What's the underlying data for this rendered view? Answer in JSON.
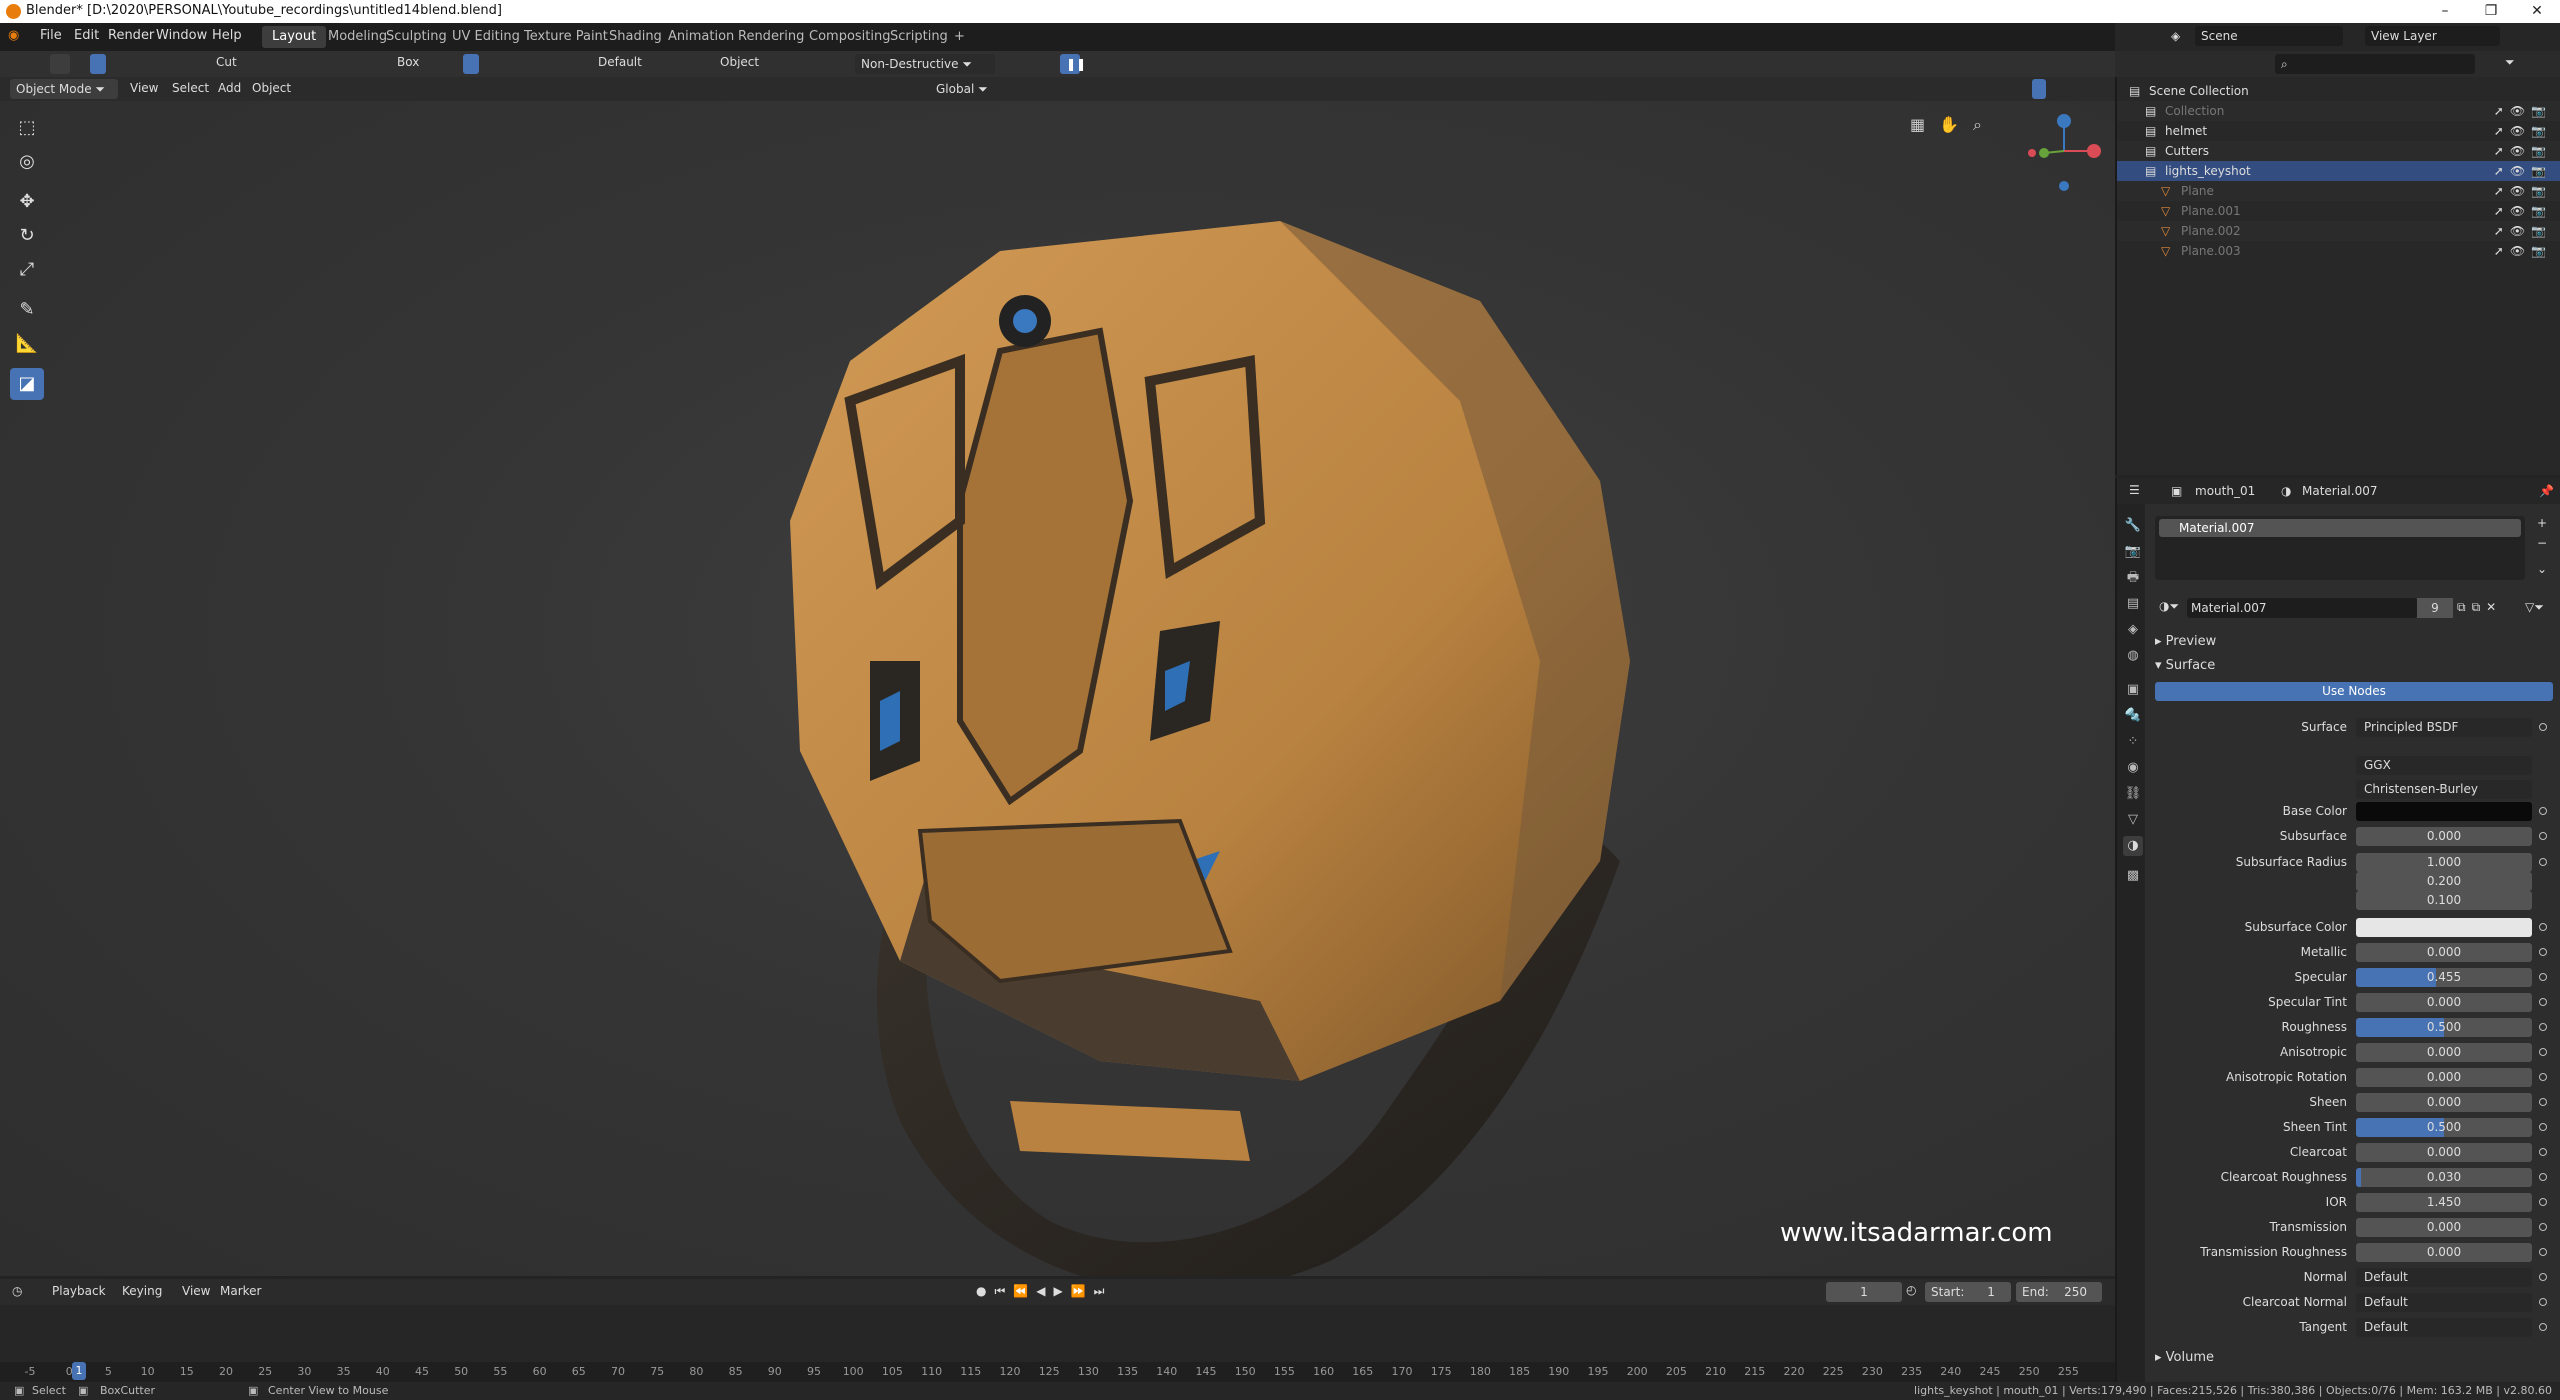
{
  "window": {
    "title": "Blender* [D:\\2020\\PERSONAL\\Youtube_recordings\\untitled14blend.blend]",
    "min": "–",
    "max": "❐",
    "close": "✕"
  },
  "menubar": {
    "items": [
      "File",
      "Edit",
      "Render",
      "Window",
      "Help"
    ]
  },
  "workspaces": [
    "Layout",
    "Modeling",
    "Sculpting",
    "UV Editing",
    "Texture Paint",
    "Shading",
    "Animation",
    "Rendering",
    "Compositing",
    "Scripting"
  ],
  "add_workspace": "+",
  "scene": {
    "label": "Scene",
    "view_layer": "View Layer"
  },
  "tool_header": {
    "cut": "Cut",
    "box": "Box",
    "default": "Default",
    "object": "Object",
    "non_destructive": "Non-Destructive"
  },
  "viewport_header": {
    "mode": "Object Mode",
    "menus": [
      "View",
      "Select",
      "Add",
      "Object"
    ],
    "orientation": "Global"
  },
  "watermark": "www.itsadarmar.com",
  "timeline": {
    "menus": [
      "Playback",
      "Keying",
      "View",
      "Marker"
    ],
    "current": "1",
    "start_label": "Start:",
    "start": "1",
    "end_label": "End:",
    "end": "250",
    "ticks": [
      "-5",
      "0",
      "5",
      "10",
      "15",
      "20",
      "25",
      "30",
      "35",
      "40",
      "45",
      "50",
      "55",
      "60",
      "65",
      "70",
      "75",
      "80",
      "85",
      "90",
      "95",
      "100",
      "105",
      "110",
      "115",
      "120",
      "125",
      "130",
      "135",
      "140",
      "145",
      "150",
      "155",
      "160",
      "165",
      "170",
      "175",
      "180",
      "185",
      "190",
      "195",
      "200",
      "205",
      "210",
      "215",
      "220",
      "225",
      "230",
      "235",
      "240",
      "245",
      "250",
      "255"
    ],
    "playhead": "1"
  },
  "statusbar": {
    "select": "Select",
    "boxcutter": "BoxCutter",
    "center": "Center View to Mouse",
    "info": "lights_keyshot | mouth_01 | Verts:179,490 | Faces:215,526 | Tris:380,386 | Objects:0/76 | Mem: 163.2 MB | v2.80.60"
  },
  "outliner": {
    "rows": [
      {
        "label": "Scene Collection",
        "indent": 0
      },
      {
        "label": "Collection",
        "indent": 1,
        "dim": true
      },
      {
        "label": "helmet",
        "indent": 1
      },
      {
        "label": "Cutters",
        "indent": 1
      },
      {
        "label": "lights_keyshot",
        "indent": 1,
        "selected": true
      },
      {
        "label": "Plane",
        "indent": 2,
        "dim": true
      },
      {
        "label": "Plane.001",
        "indent": 2,
        "dim": true
      },
      {
        "label": "Plane.002",
        "indent": 2,
        "dim": true
      },
      {
        "label": "Plane.003",
        "indent": 2,
        "dim": true
      }
    ]
  },
  "properties": {
    "object": "mouth_01",
    "material": "Material.007",
    "slot": "Material.007",
    "users": "9",
    "preview": "Preview",
    "surface_section": "Surface",
    "use_nodes": "Use Nodes",
    "volume": "Volume",
    "fields": [
      {
        "label": "Surface",
        "value": "Principled BSDF",
        "type": "dd"
      },
      {
        "label": "",
        "value": "GGX",
        "type": "dd"
      },
      {
        "label": "",
        "value": "Christensen-Burley",
        "type": "dd"
      },
      {
        "label": "Base Color",
        "value": "",
        "type": "color",
        "color": "#0a0a0a"
      },
      {
        "label": "Subsurface",
        "value": "0.000",
        "type": "num",
        "fill": 0
      },
      {
        "label": "Subsurface Radius",
        "value": "1.000",
        "type": "num",
        "fill": 0
      },
      {
        "label": "",
        "value": "0.200",
        "type": "num",
        "fill": 0
      },
      {
        "label": "",
        "value": "0.100",
        "type": "num",
        "fill": 0
      },
      {
        "label": "Subsurface Color",
        "value": "",
        "type": "color",
        "color": "#e6e6e6"
      },
      {
        "label": "Metallic",
        "value": "0.000",
        "type": "num",
        "fill": 0
      },
      {
        "label": "Specular",
        "value": "0.455",
        "type": "num",
        "fill": 0.455
      },
      {
        "label": "Specular Tint",
        "value": "0.000",
        "type": "num",
        "fill": 0
      },
      {
        "label": "Roughness",
        "value": "0.500",
        "type": "num",
        "fill": 0.5
      },
      {
        "label": "Anisotropic",
        "value": "0.000",
        "type": "num",
        "fill": 0
      },
      {
        "label": "Anisotropic Rotation",
        "value": "0.000",
        "type": "num",
        "fill": 0
      },
      {
        "label": "Sheen",
        "value": "0.000",
        "type": "num",
        "fill": 0
      },
      {
        "label": "Sheen Tint",
        "value": "0.500",
        "type": "num",
        "fill": 0.5
      },
      {
        "label": "Clearcoat",
        "value": "0.000",
        "type": "num",
        "fill": 0
      },
      {
        "label": "Clearcoat Roughness",
        "value": "0.030",
        "type": "num",
        "fill": 0.03
      },
      {
        "label": "IOR",
        "value": "1.450",
        "type": "num",
        "fill": 0
      },
      {
        "label": "Transmission",
        "value": "0.000",
        "type": "num",
        "fill": 0
      },
      {
        "label": "Transmission Roughness",
        "value": "0.000",
        "type": "num",
        "fill": 0
      },
      {
        "label": "Normal",
        "value": "Default",
        "type": "dd"
      },
      {
        "label": "Clearcoat Normal",
        "value": "Default",
        "type": "dd"
      },
      {
        "label": "Tangent",
        "value": "Default",
        "type": "dd"
      }
    ]
  }
}
